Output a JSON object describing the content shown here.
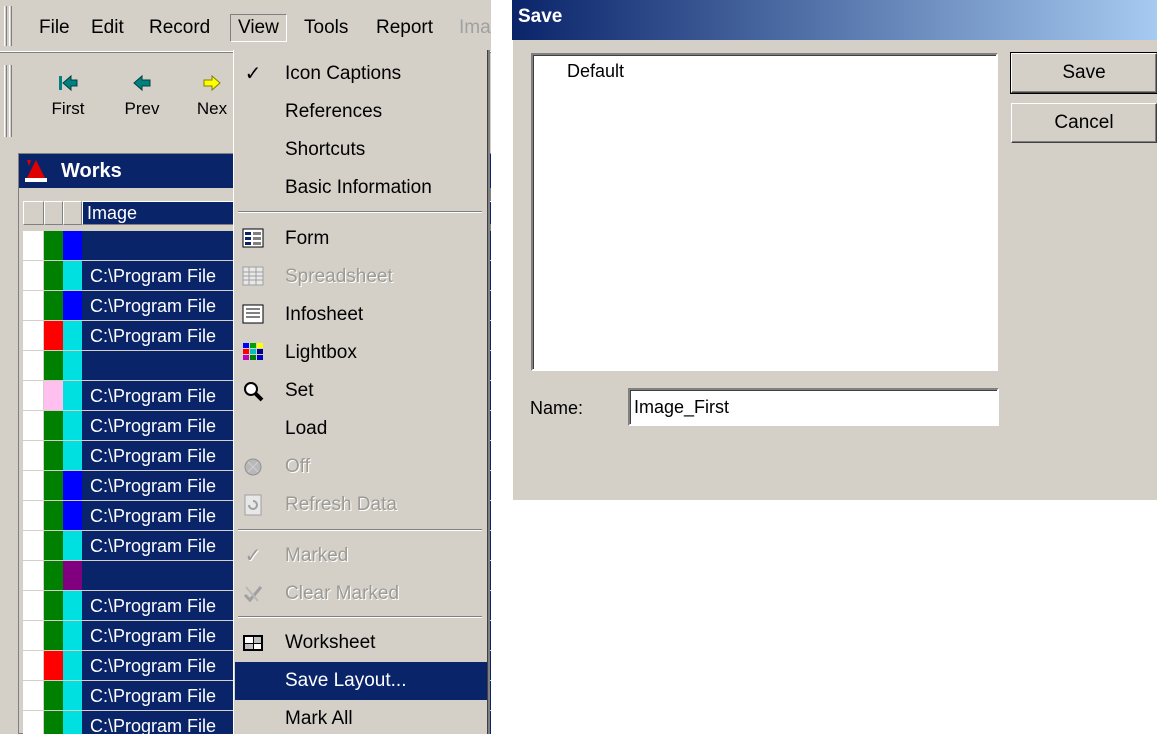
{
  "menubar": {
    "items": [
      {
        "label": "File"
      },
      {
        "label": "Edit"
      },
      {
        "label": "Record"
      },
      {
        "label": "View"
      },
      {
        "label": "Tools"
      },
      {
        "label": "Report"
      },
      {
        "label": "Ima"
      }
    ]
  },
  "toolbar": {
    "buttons": [
      {
        "label": "First",
        "icon": "first-arrow-icon"
      },
      {
        "label": "Prev",
        "icon": "prev-arrow-icon"
      },
      {
        "label": "Nex",
        "icon": "next-arrow-icon"
      }
    ]
  },
  "works": {
    "title": "Works",
    "column_header": "Image",
    "rows": [
      {
        "path": "",
        "c2": "#008000",
        "c3": "#0000ff",
        "c1": "#ffffff"
      },
      {
        "path": "C:\\Program File",
        "c2": "#008000",
        "c3": "#00e0e0",
        "c1": "#ffffff"
      },
      {
        "path": "C:\\Program File",
        "c2": "#008000",
        "c3": "#0000ff",
        "c1": "#ffffff"
      },
      {
        "path": "C:\\Program File",
        "c2": "#ff0000",
        "c3": "#00e0e0",
        "c1": "#ffffff"
      },
      {
        "path": "",
        "c2": "#008000",
        "c3": "#00e0e0",
        "c1": "#ffffff"
      },
      {
        "path": "C:\\Program File",
        "c2": "#ffc0f0",
        "c3": "#00e0e0",
        "c1": "#ffffff"
      },
      {
        "path": "C:\\Program File",
        "c2": "#008000",
        "c3": "#00e0e0",
        "c1": "#ffffff"
      },
      {
        "path": "C:\\Program File",
        "c2": "#008000",
        "c3": "#00e0e0",
        "c1": "#ffffff"
      },
      {
        "path": "C:\\Program File",
        "c2": "#008000",
        "c3": "#0000ff",
        "c1": "#ffffff"
      },
      {
        "path": "C:\\Program File",
        "c2": "#008000",
        "c3": "#0000ff",
        "c1": "#ffffff"
      },
      {
        "path": "C:\\Program File",
        "c2": "#008000",
        "c3": "#00e0e0",
        "c1": "#ffffff"
      },
      {
        "path": "",
        "c2": "#008000",
        "c3": "#800080",
        "c1": "#ffffff"
      },
      {
        "path": "C:\\Program File",
        "c2": "#008000",
        "c3": "#00e0e0",
        "c1": "#ffffff"
      },
      {
        "path": "C:\\Program File",
        "c2": "#008000",
        "c3": "#00e0e0",
        "c1": "#ffffff"
      },
      {
        "path": "C:\\Program File",
        "c2": "#ff0000",
        "c3": "#00e0e0",
        "c1": "#ffffff"
      },
      {
        "path": "C:\\Program File",
        "c2": "#008000",
        "c3": "#00e0e0",
        "c1": "#ffffff"
      },
      {
        "path": "C:\\Program File",
        "c2": "#008000",
        "c3": "#00e0e0",
        "c1": "#ffffff"
      }
    ]
  },
  "view_menu": {
    "items": [
      {
        "label": "Icon Captions",
        "icon": "check-icon",
        "state": "checked"
      },
      {
        "label": "References"
      },
      {
        "label": "Shortcuts"
      },
      {
        "label": "Basic Information"
      },
      {
        "label": "Form",
        "icon": "form-icon"
      },
      {
        "label": "Spreadsheet",
        "icon": "spreadsheet-icon",
        "state": "disabled"
      },
      {
        "label": "Infosheet",
        "icon": "infosheet-icon"
      },
      {
        "label": "Lightbox",
        "icon": "lightbox-icon"
      },
      {
        "label": "Set",
        "icon": "magnifier-icon"
      },
      {
        "label": "Load"
      },
      {
        "label": "Off",
        "icon": "off-icon",
        "state": "disabled"
      },
      {
        "label": "Refresh Data",
        "icon": "refresh-icon",
        "state": "disabled"
      },
      {
        "label": "Marked",
        "icon": "check-icon",
        "state": "disabled"
      },
      {
        "label": "Clear Marked",
        "icon": "clear-marked-icon",
        "state": "disabled"
      },
      {
        "label": "Worksheet",
        "icon": "worksheet-icon"
      },
      {
        "label": "Save Layout...",
        "state": "selected"
      },
      {
        "label": "Mark All"
      }
    ]
  },
  "save_dialog": {
    "title": "Save",
    "list_items": [
      "Default"
    ],
    "save_button": "Save",
    "cancel_button": "Cancel",
    "name_label": "Name:",
    "name_value": "Image_First"
  }
}
